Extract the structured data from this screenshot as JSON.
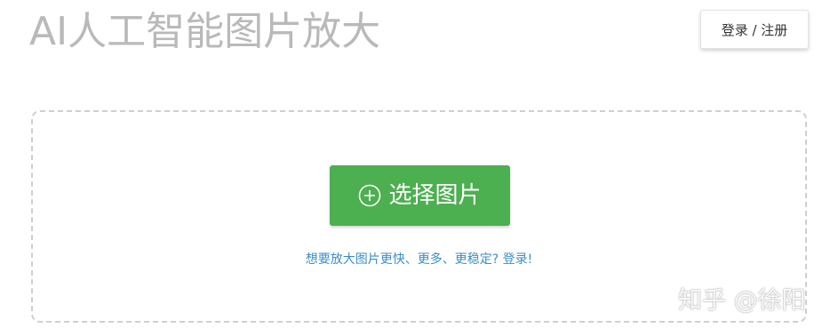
{
  "header": {
    "title": "AI人工智能图片放大",
    "login_register_label": "登录 / 注册"
  },
  "upload": {
    "select_button_label": "选择图片",
    "select_button_icon": "plus-circle-icon",
    "login_prompt": "想要放大图片更快、更多、更稳定? 登录!"
  },
  "watermark": {
    "text": "知乎 @徐阳"
  },
  "colors": {
    "accent_green": "#4caf50",
    "link_blue": "#3a8ec8",
    "title_gray": "#b9b9b9",
    "border_dashed": "#cfcfcf"
  }
}
